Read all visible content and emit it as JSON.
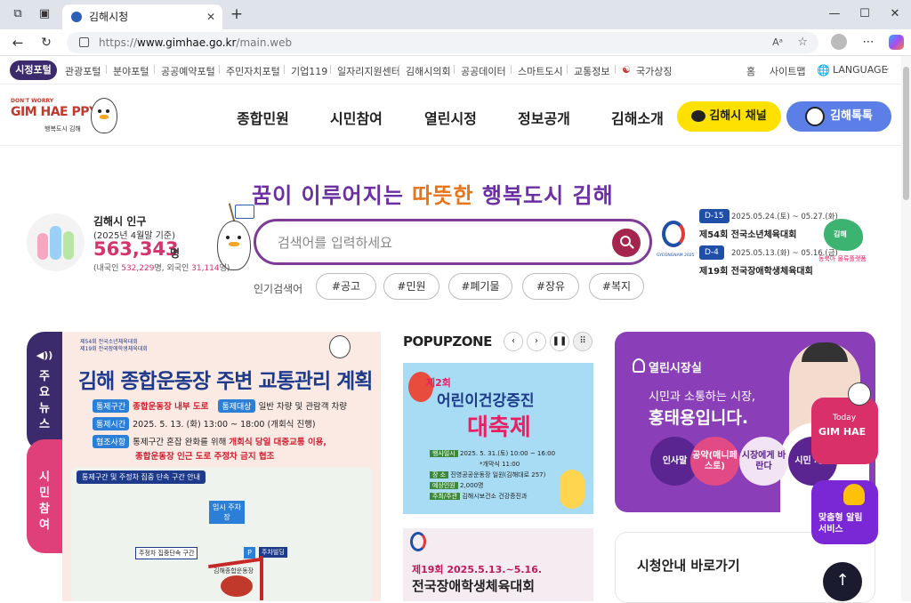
{
  "browser": {
    "tab_title": "김해시청",
    "url_prefix": "https://",
    "url_main": "www.gimhae.go.kr",
    "url_path": "/main.web"
  },
  "toplinks": {
    "portal": "시정포털",
    "items": [
      "관광포털",
      "분야포털",
      "공공예약포털",
      "주민자치포털",
      "기업119",
      "일자리지원센터",
      "김해시의회",
      "공공데이터",
      "스마트도시",
      "교통정보",
      "국가상징"
    ],
    "home": "홈",
    "sitemap": "사이트맵",
    "language": "LANGUAGE"
  },
  "header": {
    "logo_small": "DON'T WORRY",
    "logo_main": "GIM HAE PPY",
    "logo_sub": "행복도시 김해",
    "nav": [
      "종합민원",
      "시민참여",
      "열린시정",
      "정보공개",
      "김해소개"
    ],
    "channel_btn": "김해시 채널",
    "talk_btn": "김해톡톡"
  },
  "hero": {
    "slogan_part1": "꿈이 이루어지는 ",
    "slogan_part2": "따뜻한",
    "slogan_part3": " 행복도시 김해",
    "search_placeholder": "검색어를 입력하세요",
    "popular_label": "인기검색어",
    "popular_tags": [
      "#공고",
      "#민원",
      "#폐기물",
      "#장유",
      "#복지"
    ]
  },
  "population": {
    "title": "김해시 인구",
    "date": "(2025년 4월말 기준)",
    "number": "563,343",
    "unit": "명",
    "sub_prefix": "(내국인 ",
    "domestic": "532,229",
    "sub_mid": "명, 외국인 ",
    "foreign": "31,114",
    "sub_suffix": "명)"
  },
  "events": {
    "logo_caption": "GYEONGNAM 2025",
    "items": [
      {
        "dday": "D-15",
        "date": "2025.05.24.(토) ~ 05.27.(화)",
        "title": "제54회 전국소년체육대회"
      },
      {
        "dday": "D-4",
        "date": "2025.05.13.(화) ~ 05.16.(금)",
        "title": "제19회 전국장애학생체육대회"
      }
    ],
    "map_label": "김해",
    "map_caption": "동북아 물류플랫폼"
  },
  "news_tabs": {
    "tab1": [
      "주",
      "요",
      "뉴",
      "스"
    ],
    "tab2": [
      "시",
      "민",
      "참",
      "여"
    ]
  },
  "poster": {
    "org_line1": "제54회 전국소년체육대회",
    "org_line2": "제19회 전국장애학생체육대회",
    "title": "김해 종합운동장 주변 교통관리 계획",
    "rows": [
      {
        "tag": "통제구간",
        "text": "종합운동장 내부 도로",
        "tag2": "통제대상",
        "text2": "일반 차량 및 관람객 차량"
      },
      {
        "tag": "통제시간",
        "text": "2025. 5. 13. (화) 13:00 ~ 18:00 (개회식 진행)"
      },
      {
        "tag": "협조사항",
        "text": "통제구간 혼잡 완화를 위해 ",
        "red": "개회식 당일 대중교통 이용,"
      },
      {
        "red": "종합운동장 인근 도로 주정차 금지 협조"
      }
    ],
    "map_title": "통제구간 및 주정차 집중 단속 구간 안내",
    "map_labels": [
      "임시 주차장",
      "주정차 집중단속 구간",
      "P",
      "주차빌딩",
      "김해종합운동장"
    ]
  },
  "popupzone": {
    "title": "POPUPZONE",
    "card1_badge": "제2회",
    "card1_title1": "어린이건강증진",
    "card1_title2": "대축제",
    "card1_rows": [
      {
        "tag": "행사일시",
        "text": "2025. 5. 31.(토) 10:00 ~ 16:00"
      },
      {
        "tag": "장 소",
        "text": "진영공공운동장 일원(김해대로 257)"
      },
      {
        "tag": "예상인원",
        "text": "2,000명"
      },
      {
        "tag": "주최/주관",
        "text": "김해시보건소 건강증진과"
      }
    ],
    "card1_note": "*개막식 11:00",
    "card2_title": "제19회 2025.5.13.~5.16.",
    "card2_sub": "전국장애학생체육대회"
  },
  "mayor": {
    "label": "열린시장실",
    "line1": "시민과 소통하는 시장,",
    "line2": "홍태용입니다.",
    "circles": [
      "인사말",
      "공약(매니페스토)",
      "시장에게 바란다",
      "시민 제안"
    ]
  },
  "guide": {
    "title": "시청안내 바로가기"
  },
  "floating": {
    "today_small": "Today",
    "today_big": "GIM HAE",
    "custom": "맞춤형 알림 서비스"
  },
  "colors": {
    "primary": "#3b2b6c",
    "accent_pink": "#d6336c",
    "purple": "#8a3fb8",
    "channel_yellow": "#ffe100",
    "talk_blue": "#5b7fe6"
  }
}
